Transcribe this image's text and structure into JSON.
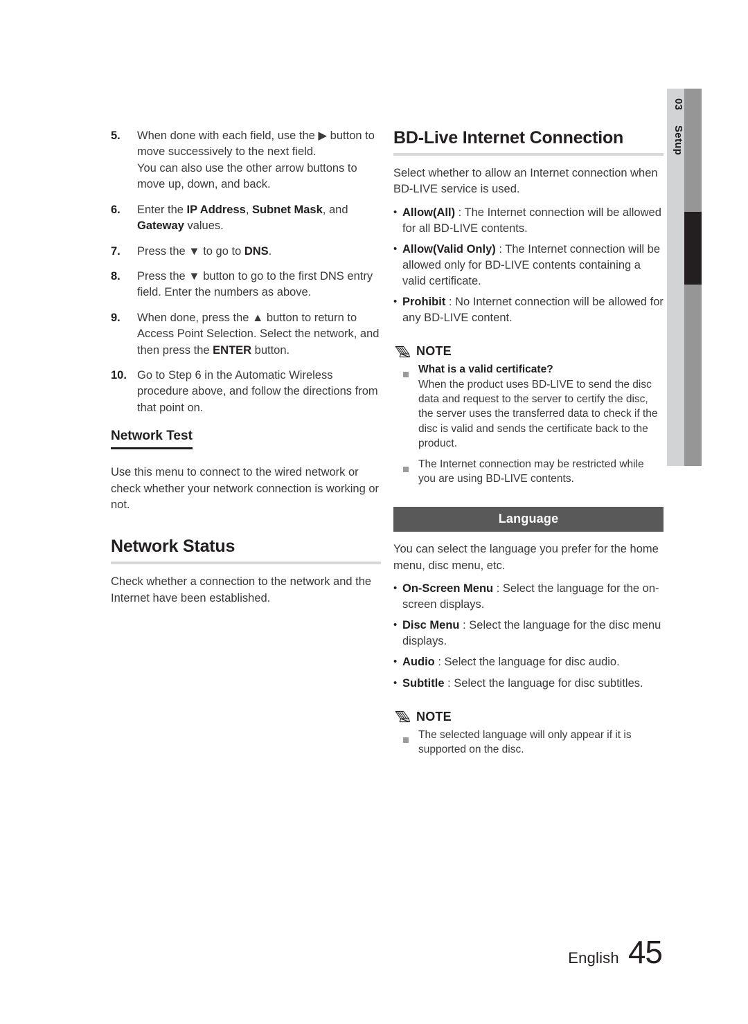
{
  "side_tab": {
    "number": "03",
    "label": "Setup"
  },
  "left_column": {
    "steps": [
      {
        "marker": "5.",
        "text": "When done with each field, use the ▶ button to move successively to the next field.\nYou can also use the other arrow buttons to move up, down, and back."
      },
      {
        "marker": "6.",
        "text_before": "Enter the ",
        "bold1": "IP Address",
        "mid1": ", ",
        "bold2": "Subnet Mask",
        "mid2": ", and ",
        "bold3": "Gateway",
        "text_after": " values."
      },
      {
        "marker": "7.",
        "text_before": "Press the ▼ to go to ",
        "bold1": "DNS",
        "text_after": "."
      },
      {
        "marker": "8.",
        "text": "Press the ▼ button to go to the first DNS entry field. Enter the numbers as above."
      },
      {
        "marker": "9.",
        "text_before": "When done, press the ▲ button to return to Access Point Selection. Select the network, and then press the ",
        "bold1": "ENTER",
        "text_after": " button."
      },
      {
        "marker": "10.",
        "text": "Go to Step 6 in the Automatic Wireless procedure above, and follow the directions from that point on."
      }
    ],
    "network_test": {
      "heading": "Network Test",
      "body": "Use this menu to connect to the wired network or check whether your network connection is working or not."
    },
    "network_status": {
      "heading": "Network Status",
      "body": "Check whether a connection to the network and the Internet have been established."
    }
  },
  "right_column": {
    "bd_live": {
      "heading": "BD-Live Internet Connection",
      "intro": "Select whether to allow an Internet connection when BD-LIVE service is used.",
      "bullets": [
        {
          "marker": "•",
          "label": "Allow(All)",
          "sep": " : ",
          "text": "The Internet connection will be allowed for all BD-LIVE contents."
        },
        {
          "marker": "•",
          "label": "Allow(Valid Only)",
          "sep": " : ",
          "text": "The Internet connection will be allowed only for BD-LIVE contents containing a valid certificate."
        },
        {
          "marker": "•",
          "label": "Prohibit",
          "sep": " : ",
          "text": "No Internet connection will be allowed for any BD-LIVE content."
        }
      ],
      "note": {
        "title": "NOTE",
        "items": [
          {
            "lead": "What is a valid certificate?",
            "text": "When the product uses BD-LIVE to send the disc data and request to the server to certify the disc, the server uses the transferred data to check if the disc is valid and sends the certificate back to the product."
          },
          {
            "lead": "",
            "text": "The Internet connection may be restricted while you are using BD-LIVE contents."
          }
        ]
      }
    },
    "language": {
      "bar_title": "Language",
      "intro": "You can select the language you prefer for the home menu, disc menu, etc.",
      "bullets": [
        {
          "marker": "•",
          "label": "On-Screen Menu",
          "sep": " : ",
          "text": "Select the language for the on-screen displays."
        },
        {
          "marker": "•",
          "label": "Disc Menu",
          "sep": " : ",
          "text": "Select the language for the disc menu displays."
        },
        {
          "marker": "•",
          "label": "Audio",
          "sep": " : ",
          "text": "Select the language for disc audio."
        },
        {
          "marker": "•",
          "label": "Subtitle",
          "sep": " : ",
          "text": "Select the language for disc subtitles."
        }
      ],
      "note": {
        "title": "NOTE",
        "items": [
          {
            "lead": "",
            "text": "The selected language will only appear if it is supported on the disc."
          }
        ]
      }
    }
  },
  "footer": {
    "language": "English",
    "page": "45"
  },
  "colors": {
    "text": "#3a3a3a",
    "heading": "#231f20",
    "rule": "#d9d9d9",
    "section_bar": "#595959",
    "tab_light": "#d2d3d5",
    "tab_gray": "#969696",
    "tab_marker": "#231f20",
    "bullet_square": "#9b9b9b"
  }
}
